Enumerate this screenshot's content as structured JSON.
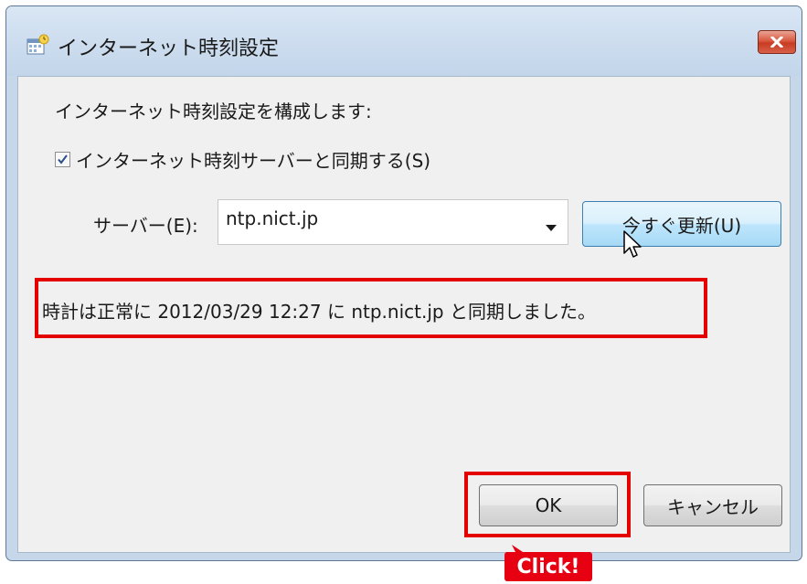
{
  "window": {
    "title": "インターネット時刻設定",
    "icon": "calendar-clock-icon",
    "close_icon": "close-icon"
  },
  "dialog": {
    "intro": "インターネット時刻設定を構成します:",
    "sync_checkbox": {
      "label": "インターネット時刻サーバーと同期する(S)",
      "checked": true
    },
    "server_label": "サーバー(E):",
    "server_value": "ntp.nict.jp",
    "update_button": "今すぐ更新(U)",
    "status": "時計は正常に 2012/03/29 12:27 に ntp.nict.jp と同期しました。",
    "ok_button": "OK",
    "cancel_button": "キャンセル"
  },
  "annotation": {
    "click_label": "Click!",
    "highlight_color": "#e50000"
  },
  "colors": {
    "titlebar": "#c7d7ea",
    "client": "#f0f0f0",
    "close_button": "#c73c22",
    "update_button": "#bee6fd"
  }
}
